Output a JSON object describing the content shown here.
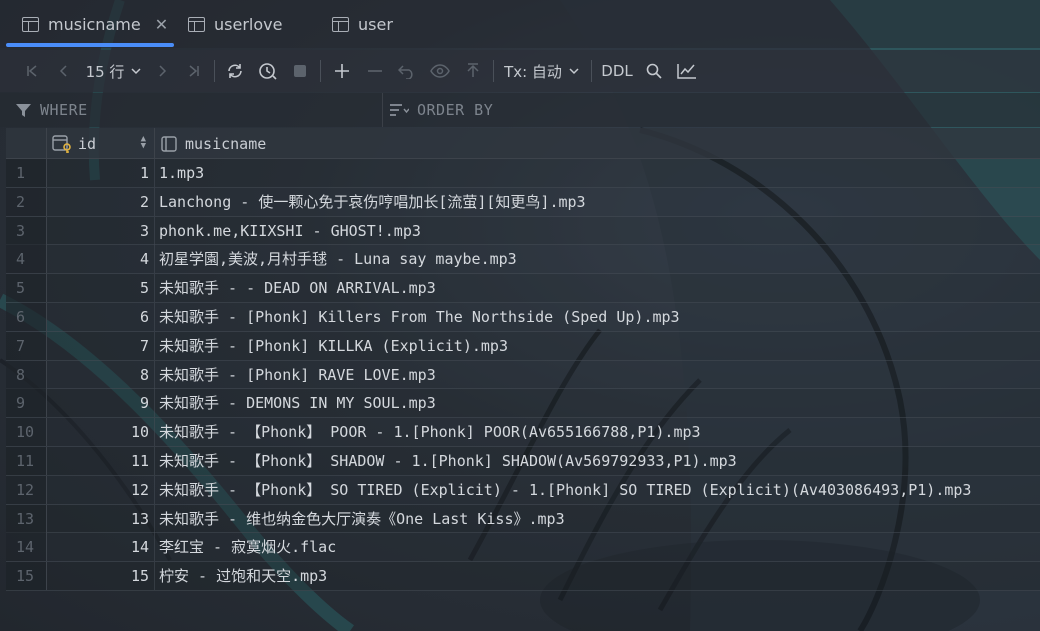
{
  "tabs": [
    {
      "label": "musicname",
      "icon": "table-icon",
      "active": true
    },
    {
      "label": "userlove",
      "icon": "table-icon",
      "active": false
    },
    {
      "label": "user",
      "icon": "table-icon",
      "active": false
    }
  ],
  "toolbar": {
    "rows_label": "15 行",
    "tx_label": "Tx: 自动",
    "ddl_label": "DDL"
  },
  "filter": {
    "where_placeholder": "WHERE",
    "order_placeholder": "ORDER BY"
  },
  "grid": {
    "columns": [
      {
        "label": "id",
        "icon": "key-column-icon"
      },
      {
        "label": "musicname",
        "icon": "text-column-icon"
      }
    ],
    "rows": [
      {
        "num": "1",
        "id": "1",
        "musicname": "1.mp3"
      },
      {
        "num": "2",
        "id": "2",
        "musicname": "Lanchong - 使一颗心免于哀伤哼唱加长[流萤][知更鸟].mp3"
      },
      {
        "num": "3",
        "id": "3",
        "musicname": "phonk.me,KIIXSHI - GHOST!.mp3"
      },
      {
        "num": "4",
        "id": "4",
        "musicname": "初星学園,美波,月村手毬 - Luna say maybe.mp3"
      },
      {
        "num": "5",
        "id": "5",
        "musicname": "未知歌手 - - DEAD ON ARRIVAL.mp3"
      },
      {
        "num": "6",
        "id": "6",
        "musicname": "未知歌手 - [Phonk] Killers From The Northside (Sped Up).mp3"
      },
      {
        "num": "7",
        "id": "7",
        "musicname": "未知歌手 - [Phonk] KILLKA (Explicit).mp3"
      },
      {
        "num": "8",
        "id": "8",
        "musicname": "未知歌手 - [Phonk] RAVE LOVE.mp3"
      },
      {
        "num": "9",
        "id": "9",
        "musicname": "未知歌手 - DEMONS IN MY SOUL.mp3"
      },
      {
        "num": "10",
        "id": "10",
        "musicname": "未知歌手 - 【Phonk】 POOR - 1.[Phonk] POOR(Av655166788,P1).mp3"
      },
      {
        "num": "11",
        "id": "11",
        "musicname": "未知歌手 - 【Phonk】 SHADOW - 1.[Phonk] SHADOW(Av569792933,P1).mp3"
      },
      {
        "num": "12",
        "id": "12",
        "musicname": "未知歌手 - 【Phonk】 SO TIRED (Explicit) - 1.[Phonk] SO TIRED (Explicit)(Av403086493,P1).mp3"
      },
      {
        "num": "13",
        "id": "13",
        "musicname": "未知歌手 - 维也纳金色大厅演奏《One Last Kiss》.mp3"
      },
      {
        "num": "14",
        "id": "14",
        "musicname": "李红宝 - 寂寞烟火.flac"
      },
      {
        "num": "15",
        "id": "15",
        "musicname": "柠安 - 过饱和天空.mp3"
      }
    ]
  },
  "colors": {
    "accent": "#4a8df8",
    "background": "#2b323b",
    "text": "#d4d8dd"
  }
}
